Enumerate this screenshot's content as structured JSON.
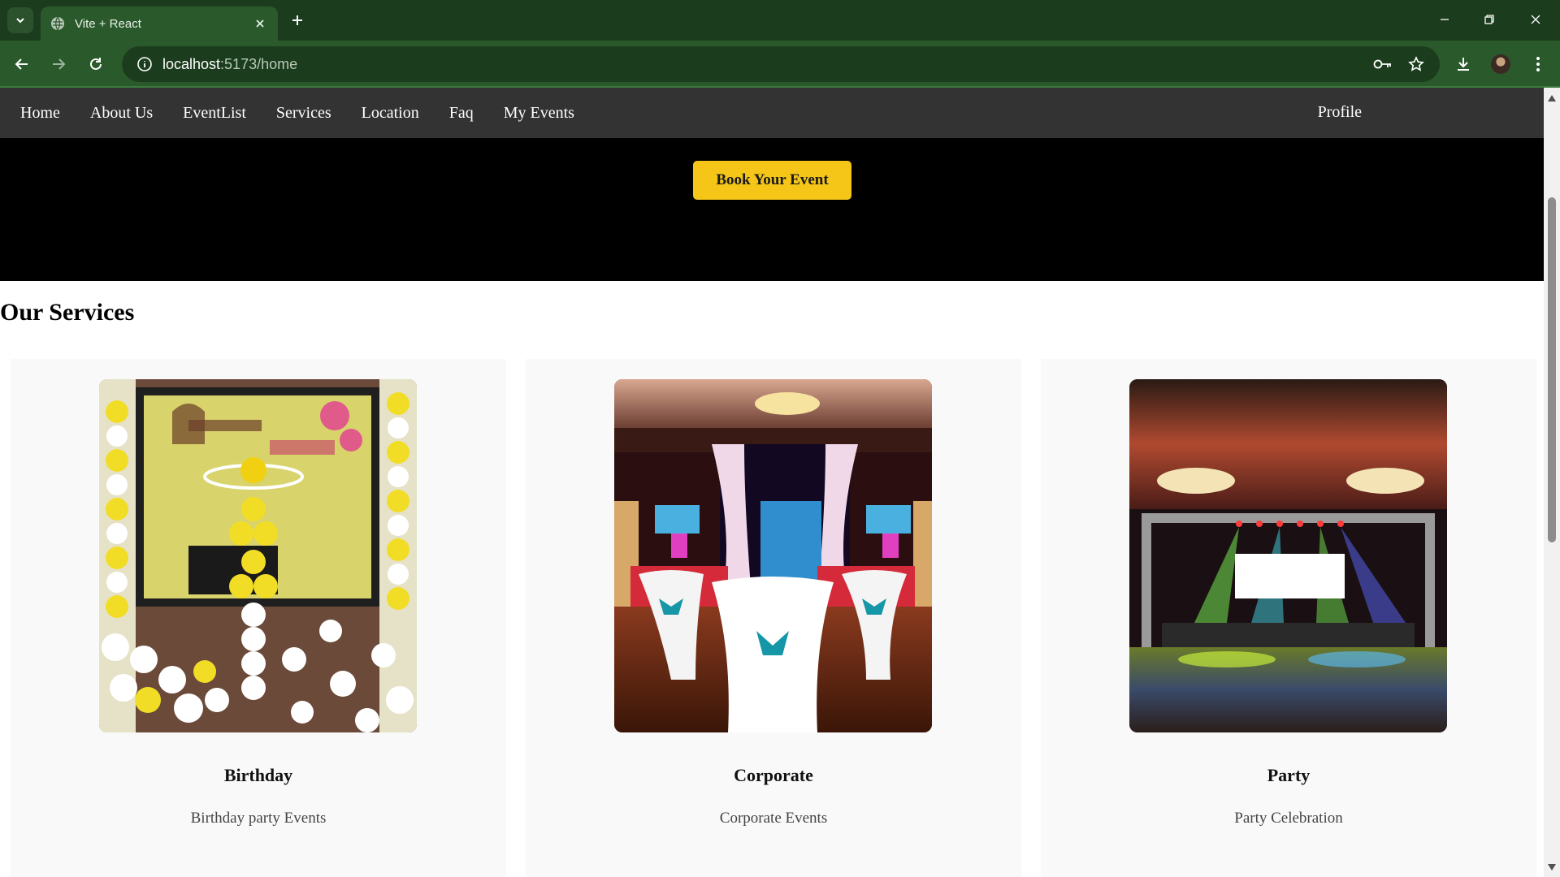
{
  "browser": {
    "tab_title": "Vite + React",
    "url_host": "localhost",
    "url_rest": ":5173/home"
  },
  "nav": {
    "links": [
      "Home",
      "About Us",
      "EventList",
      "Services",
      "Location",
      "Faq",
      "My Events"
    ],
    "profile": "Profile"
  },
  "hero": {
    "button_label": "Book Your Event"
  },
  "services": {
    "title": "Our Services",
    "cards": [
      {
        "title": "Birthday",
        "description": "Birthday party Events",
        "image": "birthday-photo"
      },
      {
        "title": "Corporate",
        "description": "Corporate Events",
        "image": "corporate-photo"
      },
      {
        "title": "Party",
        "description": "Party Celebration",
        "image": "party-photo"
      }
    ]
  },
  "colors": {
    "browser_frame": "#1c3d1d",
    "toolbar": "#2a5a2b",
    "site_nav": "#333333",
    "hero": "#000000",
    "accent_button": "#f5c518"
  }
}
